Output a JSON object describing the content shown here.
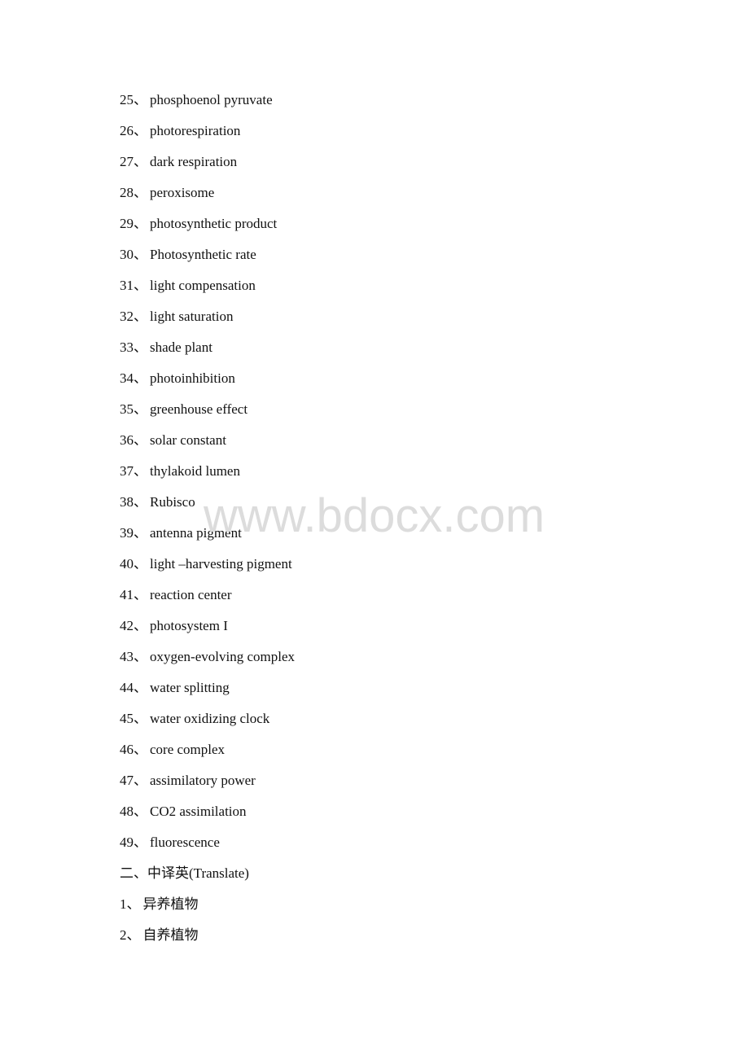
{
  "section1": {
    "items": [
      {
        "num": "25",
        "sep": "、",
        "text": "phosphoenol pyruvate"
      },
      {
        "num": "26",
        "sep": "、",
        "text": "photorespiration"
      },
      {
        "num": "27",
        "sep": "、",
        "text": "dark respiration"
      },
      {
        "num": "28",
        "sep": "、",
        "text": "peroxisome"
      },
      {
        "num": "29",
        "sep": "、",
        "text": "photosynthetic product"
      },
      {
        "num": "30",
        "sep": "、",
        "text": "Photosynthetic rate"
      },
      {
        "num": "31",
        "sep": "、",
        "text": "light compensation"
      },
      {
        "num": "32",
        "sep": "、",
        "text": "light saturation"
      },
      {
        "num": "33",
        "sep": "、",
        "text": "shade plant"
      },
      {
        "num": "34",
        "sep": "、",
        "text": "photoinhibition"
      },
      {
        "num": "35",
        "sep": "、",
        "text": "greenhouse effect"
      },
      {
        "num": "36",
        "sep": "、",
        "text": "solar constant"
      },
      {
        "num": "37",
        "sep": "、",
        "text": "thylakoid lumen"
      },
      {
        "num": "38",
        "sep": "、",
        "text": "Rubisco"
      },
      {
        "num": "39",
        "sep": "、",
        "text": "antenna pigment"
      },
      {
        "num": "40",
        "sep": "、",
        "text": "light –harvesting pigment"
      },
      {
        "num": "41",
        "sep": "、",
        "text": "reaction center"
      },
      {
        "num": "42",
        "sep": "、",
        "text": "photosystem I"
      },
      {
        "num": "43",
        "sep": "、",
        "text": "oxygen-evolving complex"
      },
      {
        "num": "44",
        "sep": "、",
        "text": "water splitting"
      },
      {
        "num": "45",
        "sep": "、",
        "text": "water oxidizing clock"
      },
      {
        "num": "46",
        "sep": "、",
        "text": "core complex"
      },
      {
        "num": "47",
        "sep": "、",
        "text": "assimilatory power"
      },
      {
        "num": "48",
        "sep": "、",
        "text": "CO2 assimilation"
      },
      {
        "num": "49",
        "sep": "、",
        "text": "fluorescence"
      }
    ]
  },
  "section2": {
    "heading": "二、中译英(Translate)",
    "items": [
      {
        "num": "1",
        "sep": "、",
        "text": "异养植物"
      },
      {
        "num": "2",
        "sep": "、",
        "text": "自养植物"
      }
    ]
  },
  "watermark": "www.bdocx.com"
}
